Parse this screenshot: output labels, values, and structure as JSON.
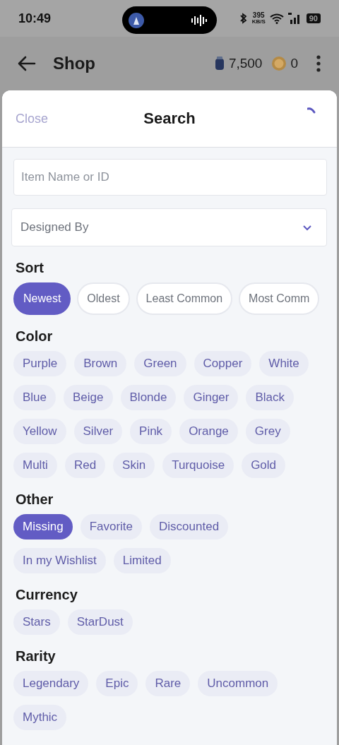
{
  "status_bar": {
    "time": "10:49",
    "network_speed": "395",
    "speed_unit": "KB/S",
    "battery": "90"
  },
  "app_bar": {
    "title": "Shop",
    "stars_balance": "7,500",
    "coins_balance": "0"
  },
  "sheet": {
    "close": "Close",
    "title": "Search",
    "search_field": {
      "placeholder": "Item Name or ID"
    },
    "designer_select": {
      "placeholder": "Designed By"
    },
    "sections": [
      {
        "heading": "Sort",
        "kind": "outlined",
        "options": [
          {
            "label": "Newest",
            "selected": true
          },
          {
            "label": "Oldest",
            "selected": false
          },
          {
            "label": "Least Common",
            "selected": false
          },
          {
            "label": "Most Comm",
            "selected": false
          }
        ]
      },
      {
        "heading": "Color",
        "kind": "filled",
        "options": [
          {
            "label": "Purple",
            "selected": false
          },
          {
            "label": "Brown",
            "selected": false
          },
          {
            "label": "Green",
            "selected": false
          },
          {
            "label": "Copper",
            "selected": false
          },
          {
            "label": "White",
            "selected": false
          },
          {
            "label": "Blue",
            "selected": false
          },
          {
            "label": "Beige",
            "selected": false
          },
          {
            "label": "Blonde",
            "selected": false
          },
          {
            "label": "Ginger",
            "selected": false
          },
          {
            "label": "Black",
            "selected": false
          },
          {
            "label": "Yellow",
            "selected": false
          },
          {
            "label": "Silver",
            "selected": false
          },
          {
            "label": "Pink",
            "selected": false
          },
          {
            "label": "Orange",
            "selected": false
          },
          {
            "label": "Grey",
            "selected": false
          },
          {
            "label": "Multi",
            "selected": false
          },
          {
            "label": "Red",
            "selected": false
          },
          {
            "label": "Skin",
            "selected": false
          },
          {
            "label": "Turquoise",
            "selected": false
          },
          {
            "label": "Gold",
            "selected": false
          }
        ]
      },
      {
        "heading": "Other",
        "kind": "filled",
        "options": [
          {
            "label": "Missing",
            "selected": true
          },
          {
            "label": "Favorite",
            "selected": false
          },
          {
            "label": "Discounted",
            "selected": false
          },
          {
            "label": "In my Wishlist",
            "selected": false
          },
          {
            "label": "Limited",
            "selected": false
          }
        ]
      },
      {
        "heading": "Currency",
        "kind": "filled",
        "options": [
          {
            "label": "Stars",
            "selected": false
          },
          {
            "label": "StarDust",
            "selected": false
          }
        ]
      },
      {
        "heading": "Rarity",
        "kind": "filled",
        "options": [
          {
            "label": "Legendary",
            "selected": false
          },
          {
            "label": "Epic",
            "selected": false
          },
          {
            "label": "Rare",
            "selected": false
          },
          {
            "label": "Uncommon",
            "selected": false
          },
          {
            "label": "Mythic",
            "selected": false
          }
        ]
      }
    ]
  }
}
